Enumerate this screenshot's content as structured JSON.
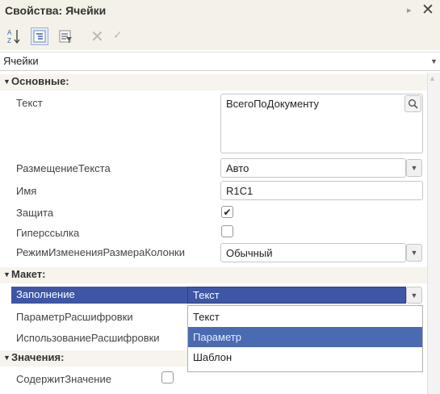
{
  "window": {
    "title": "Свойства: Ячейки"
  },
  "object_selector": {
    "value": "Ячейки"
  },
  "sections": {
    "main": {
      "title": "Основные:"
    },
    "layout": {
      "title": "Макет:"
    },
    "values": {
      "title": "Значения:"
    }
  },
  "properties": {
    "text": {
      "label": "Текст",
      "value": "ВсегоПоДокументу"
    },
    "text_placement": {
      "label": "РазмещениеТекста",
      "value": "Авто"
    },
    "name": {
      "label": "Имя",
      "value": "R1C1"
    },
    "protection": {
      "label": "Защита",
      "checked": true
    },
    "hyperlink": {
      "label": "Гиперссылка",
      "checked": false
    },
    "column_resize_mode": {
      "label": "РежимИзмененияРазмераКолонки",
      "value": "Обычный"
    },
    "fill": {
      "label": "Заполнение",
      "value": "Текст"
    },
    "decode_param": {
      "label": "ПараметрРасшифровки"
    },
    "decode_use": {
      "label": "ИспользованиеРасшифровки"
    },
    "contains_value": {
      "label": "СодержитЗначение",
      "checked": false
    }
  },
  "fill_dropdown": {
    "options": [
      "Текст",
      "Параметр",
      "Шаблон"
    ],
    "highlighted_option": "Параметр"
  },
  "marks": {
    "checkmark": "✔"
  },
  "colors": {
    "selection": "#3d56a6",
    "highlight": "#4a6bb2",
    "panel": "#f4f2e8"
  },
  "icons": [
    "sort-az-icon",
    "category-view-icon",
    "filter-icon",
    "delete-icon",
    "checkmark-icon",
    "search-icon",
    "close-icon",
    "dropdown-arrow-icon"
  ]
}
